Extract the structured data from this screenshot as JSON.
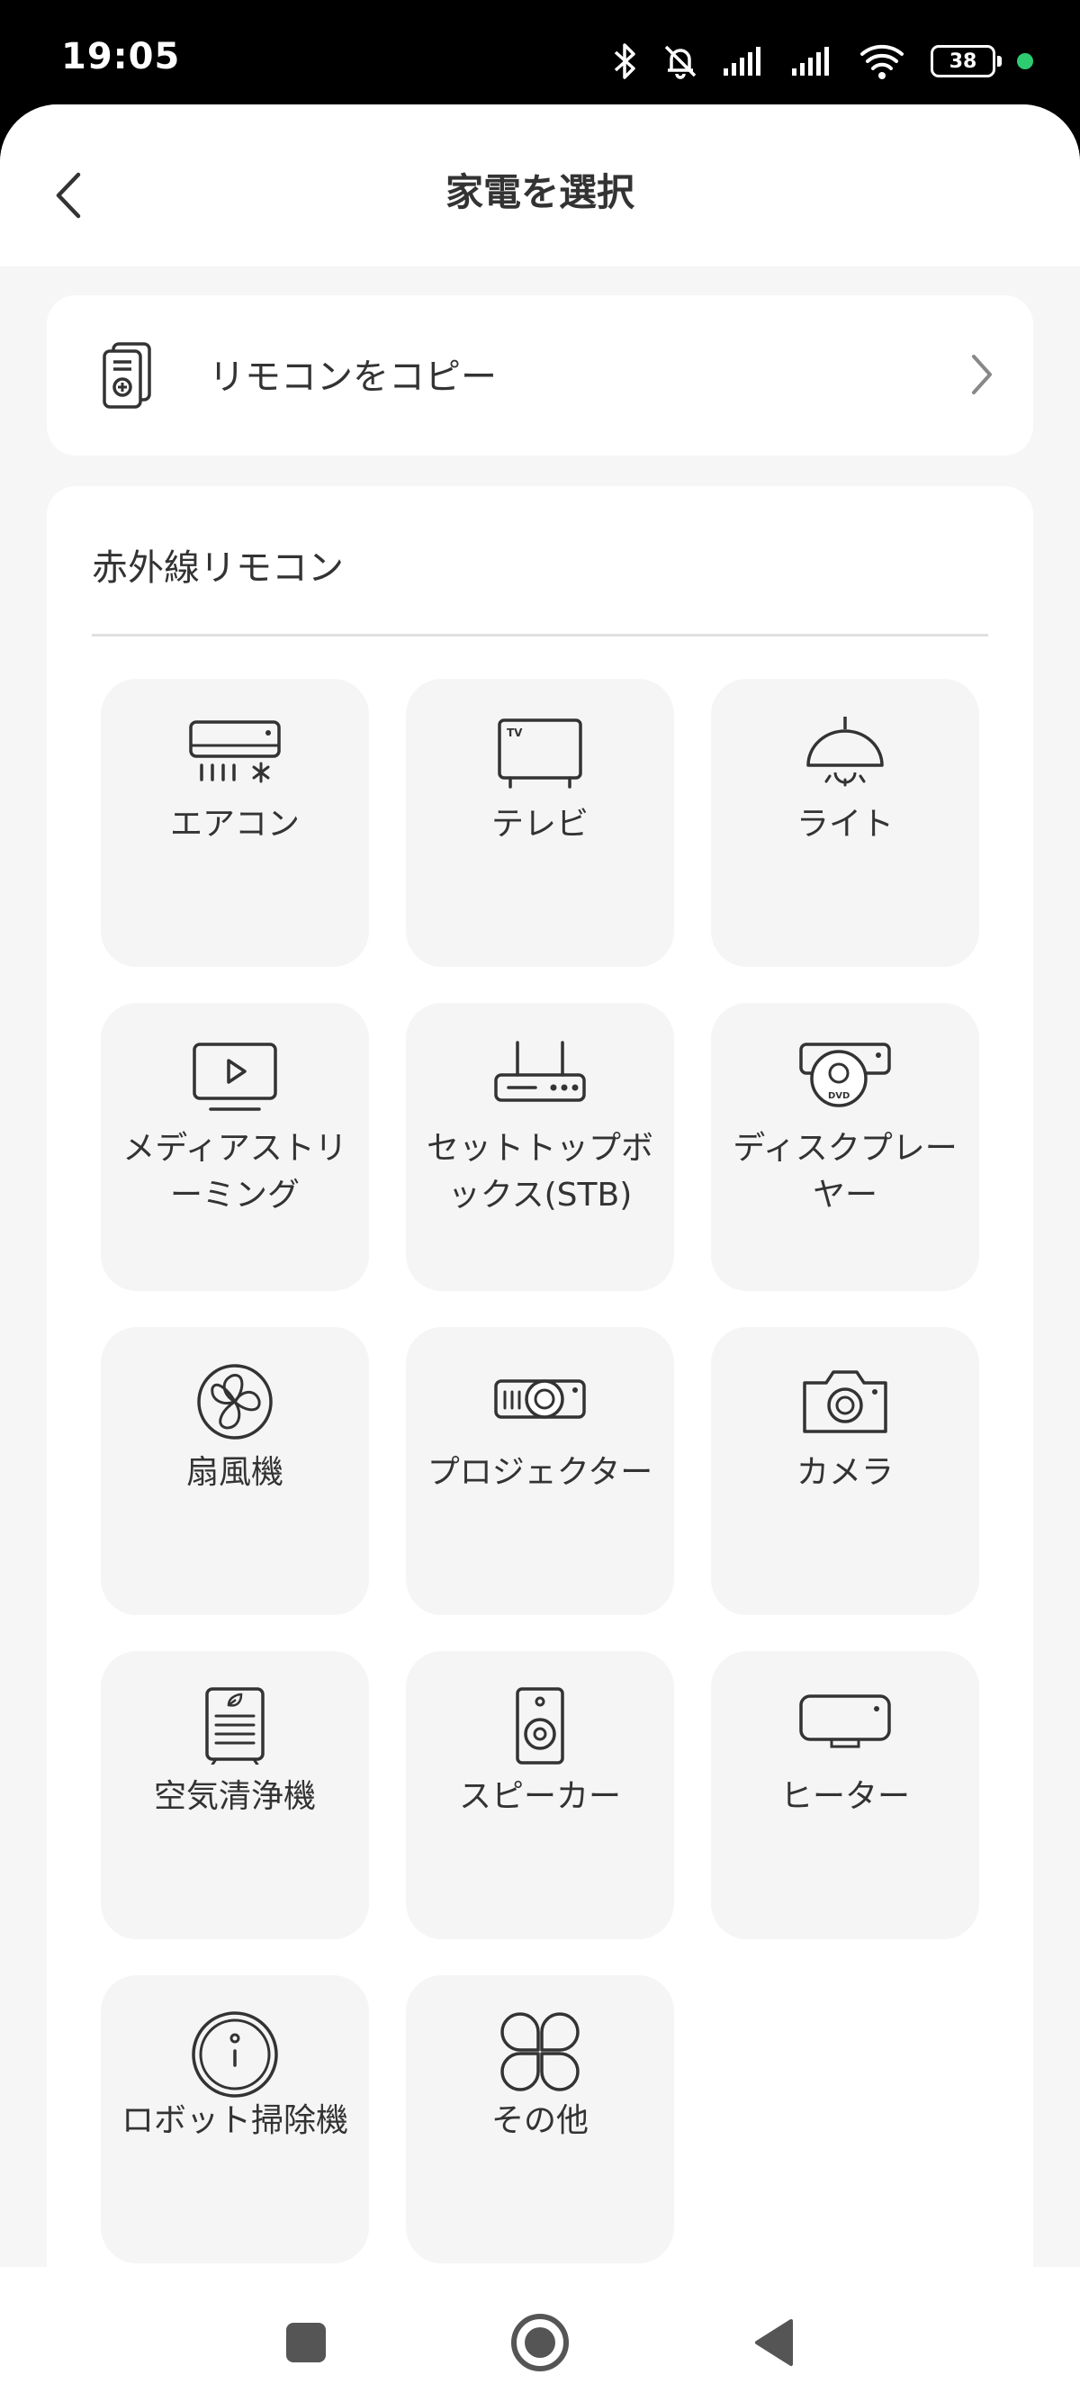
{
  "status": {
    "time": "19:05",
    "battery": "38",
    "icons": [
      "bluetooth-icon",
      "mute-icon",
      "signal-icon",
      "signal-icon",
      "wifi-icon",
      "battery-icon"
    ],
    "dot_color": "#2ecc71"
  },
  "header": {
    "title": "家電を選択",
    "back_icon": "back-chevron-icon"
  },
  "copy_remote": {
    "label": "リモコンをコピー",
    "icon": "remote-copy-icon"
  },
  "ir_section": {
    "title": "赤外線リモコン",
    "items": [
      {
        "label": "エアコン",
        "icon": "air-conditioner-icon"
      },
      {
        "label": "テレビ",
        "icon": "tv-icon"
      },
      {
        "label": "ライト",
        "icon": "lamp-icon"
      },
      {
        "label": "メディアストリーミング",
        "icon": "media-streaming-icon"
      },
      {
        "label": "セットトップボックス(STB)",
        "icon": "set-top-box-icon"
      },
      {
        "label": "ディスクプレーヤー",
        "icon": "disc-player-icon"
      },
      {
        "label": "扇風機",
        "icon": "fan-icon"
      },
      {
        "label": "プロジェクター",
        "icon": "projector-icon"
      },
      {
        "label": "カメラ",
        "icon": "camera-icon"
      },
      {
        "label": "空気清浄機",
        "icon": "air-purifier-icon"
      },
      {
        "label": "スピーカー",
        "icon": "speaker-icon"
      },
      {
        "label": "ヒーター",
        "icon": "heater-icon"
      },
      {
        "label": "ロボット掃除機",
        "icon": "robot-vacuum-icon"
      },
      {
        "label": "その他",
        "icon": "other-icon"
      }
    ]
  },
  "navbar": {
    "icons": [
      "recents-square-icon",
      "home-circle-icon",
      "back-triangle-icon"
    ]
  },
  "colors": {
    "background": "#f6f6f6",
    "card": "#ffffff",
    "tile": "#f5f5f5",
    "text": "#333333"
  }
}
